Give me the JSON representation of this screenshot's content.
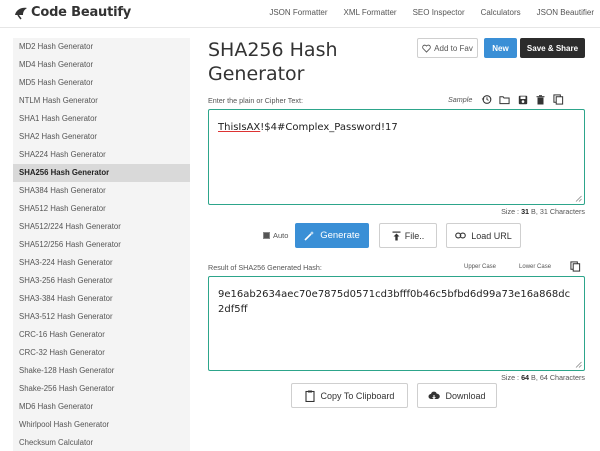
{
  "brand": {
    "name": "Code Beautify"
  },
  "nav": {
    "items": [
      "JSON Formatter",
      "XML Formatter",
      "SEO Inspector",
      "Calculators",
      "JSON Beautifier"
    ]
  },
  "sidebar": {
    "items": [
      "MD2 Hash Generator",
      "MD4 Hash Generator",
      "MD5 Hash Generator",
      "NTLM Hash Generator",
      "SHA1 Hash Generator",
      "SHA2 Hash Generator",
      "SHA224 Hash Generator",
      "SHA256 Hash Generator",
      "SHA384 Hash Generator",
      "SHA512 Hash Generator",
      "SHA512/224 Hash Generator",
      "SHA512/256 Hash Generator",
      "SHA3-224 Hash Generator",
      "SHA3-256 Hash Generator",
      "SHA3-384 Hash Generator",
      "SHA3-512 Hash Generator",
      "CRC-16 Hash Generator",
      "CRC-32 Hash Generator",
      "Shake-128 Hash Generator",
      "Shake-256 Hash Generator",
      "MD6 Hash Generator",
      "Whirlpool Hash Generator",
      "Checksum Calculator"
    ],
    "active": "SHA256 Hash Generator"
  },
  "page": {
    "title_line1": "SHA256 Hash",
    "title_line2": "Generator"
  },
  "header_buttons": {
    "fav": "Add to Fav",
    "new": "New",
    "save": "Save & Share"
  },
  "input": {
    "label": "Enter the plain or Cipher Text:",
    "sample": "Sample",
    "value_underlined": "ThisIsAX",
    "value_rest": "!$4#Complex_Password!17",
    "size_prefix": "Size : ",
    "size_bytes": "31",
    "size_suffix": " B, 31 Characters"
  },
  "controls": {
    "auto": "Auto",
    "generate": "Generate",
    "file": "File..",
    "load_url": "Load URL"
  },
  "output": {
    "label": "Result of SHA256 Generated Hash:",
    "upper_case": "Upper Case",
    "lower_case": "Lower Case",
    "value": "9e16ab2634aec70e7875d0571cd3bfff0b46c5bfbd6d99a73e16a868dc2df5ff",
    "size_prefix": "Size : ",
    "size_bytes": "64",
    "size_suffix": " B, 64 Characters"
  },
  "footer_buttons": {
    "copy": "Copy To Clipboard",
    "download": "Download"
  },
  "colors": {
    "accent_blue": "#3a8fd6",
    "textarea_border": "#2da58b",
    "dark_button": "#2c2c2c"
  }
}
